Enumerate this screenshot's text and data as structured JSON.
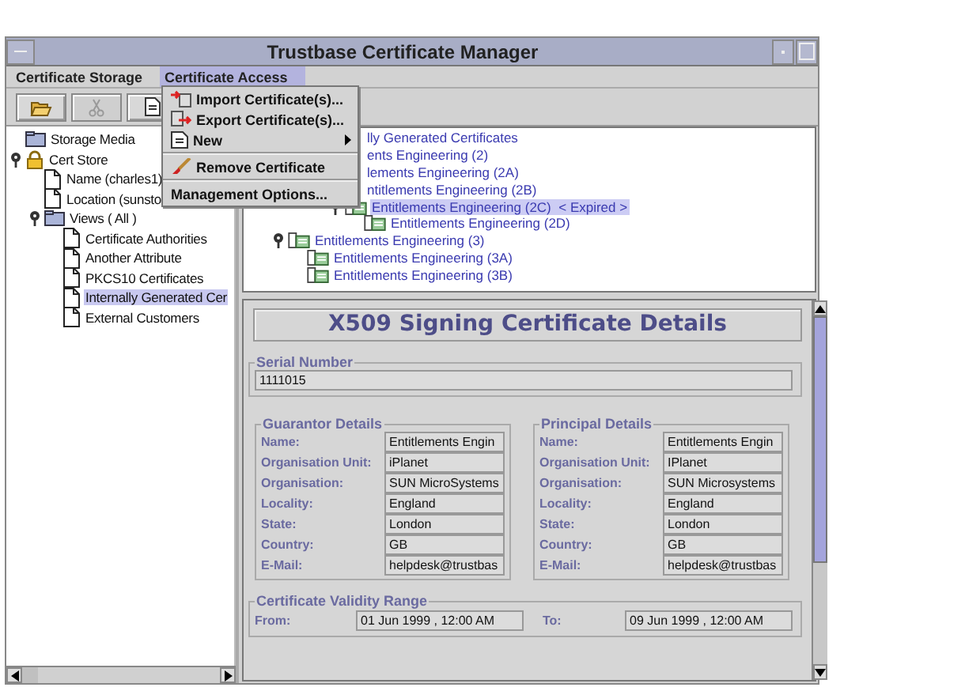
{
  "window": {
    "title": "Trustbase Certificate Manager"
  },
  "menubar": [
    {
      "label": "Certificate Storage",
      "selected": false
    },
    {
      "label": "Certificate Access",
      "selected": true
    }
  ],
  "toolbar": [
    {
      "kind": "open",
      "disabled": false
    },
    {
      "kind": "cut",
      "disabled": true
    },
    {
      "kind": "document",
      "disabled": false
    }
  ],
  "menu": [
    {
      "kind": "item",
      "label": "Import Certificate(s)...",
      "submenu": false
    },
    {
      "kind": "item",
      "label": "Export Certificate(s)...",
      "submenu": false
    },
    {
      "kind": "item",
      "label": "New",
      "submenu": true
    },
    {
      "kind": "separator"
    },
    {
      "kind": "item",
      "label": "Remove Certificate",
      "submenu": false
    },
    {
      "kind": "separator"
    },
    {
      "kind": "item",
      "label": "Management Options...",
      "submenu": false
    }
  ],
  "storage_tree": [
    {
      "label": "Storage Media",
      "kind": "folder",
      "selected": false
    },
    {
      "label": "Cert Store",
      "kind": "store",
      "selected": false,
      "expanded": true,
      "children": [
        {
          "label": "Name (charles1)",
          "kind": "document",
          "selected": false
        },
        {
          "label": "Location (sunsto",
          "kind": "document",
          "selected": false
        },
        {
          "label": "Views ( All )",
          "kind": "folder",
          "selected": false,
          "expanded": true,
          "children": [
            {
              "label": "Certificate Authorities",
              "kind": "document",
              "selected": false
            },
            {
              "label": "Another Attribute",
              "kind": "document",
              "selected": false
            },
            {
              "label": "PKCS10 Certificates",
              "kind": "document",
              "selected": false
            },
            {
              "label": "Internally Generated Cer",
              "kind": "document",
              "selected": true
            },
            {
              "label": "External Customers",
              "kind": "document",
              "selected": false
            }
          ]
        }
      ]
    }
  ],
  "certificate_tree": [
    {
      "label": "lly Generated Certificates",
      "cut": true,
      "selected": false,
      "children": [
        {
          "label": "ents Engineering (2)",
          "cut": true,
          "selected": false,
          "children": [
            {
              "label": "lements Engineering (2A)",
              "cut": true,
              "selected": false,
              "children": [
                {
                  "label": "ntitlements Engineering (2B)",
                  "cut": true,
                  "selected": false,
                  "children": [
                    {
                      "label": "Entitlements Engineering (2C)",
                      "note": "< Expired >",
                      "cut": false,
                      "selected": true,
                      "expanded": true,
                      "children": [
                        {
                          "label": "Entitlements Engineering (2D)",
                          "cut": false,
                          "selected": false
                        }
                      ]
                    }
                  ]
                }
              ]
            }
          ]
        },
        {
          "label": "Entitlements Engineering (3)",
          "cut": false,
          "selected": false,
          "expanded": true,
          "children": [
            {
              "label": "Entitlements Engineering (3A)",
              "cut": false,
              "selected": false
            },
            {
              "label": "Entitlements Engineering (3B)",
              "cut": false,
              "selected": false
            }
          ]
        }
      ]
    }
  ],
  "details": {
    "title": "X509 Signing Certificate Details",
    "serial": {
      "legend": "Serial Number",
      "value": "1111015"
    },
    "parties": [
      {
        "legend": "Guarantor Details",
        "fields": [
          {
            "label": "Name:",
            "value": "Entitlements Engin"
          },
          {
            "label": "Organisation Unit:",
            "value": "iPlanet"
          },
          {
            "label": "Organisation:",
            "value": "SUN MicroSystems"
          },
          {
            "label": "Locality:",
            "value": "England"
          },
          {
            "label": "State:",
            "value": "London"
          },
          {
            "label": "Country:",
            "value": "GB"
          },
          {
            "label": "E-Mail:",
            "value": "helpdesk@trustbas"
          }
        ]
      },
      {
        "legend": "Principal Details",
        "fields": [
          {
            "label": "Name:",
            "value": "Entitlements Engin"
          },
          {
            "label": "Organisation Unit:",
            "value": "IPlanet"
          },
          {
            "label": "Organisation:",
            "value": "SUN Microsystems"
          },
          {
            "label": "Locality:",
            "value": "England"
          },
          {
            "label": "State:",
            "value": "London"
          },
          {
            "label": "Country:",
            "value": "GB"
          },
          {
            "label": "E-Mail:",
            "value": "helpdesk@trustbas"
          }
        ]
      }
    ],
    "validity": {
      "legend": "Certificate Validity Range",
      "from_label": "From:",
      "from": "01 Jun 1999 , 12:00 AM",
      "to_label": "To:",
      "to": "09 Jun 1999 , 12:00 AM"
    }
  }
}
